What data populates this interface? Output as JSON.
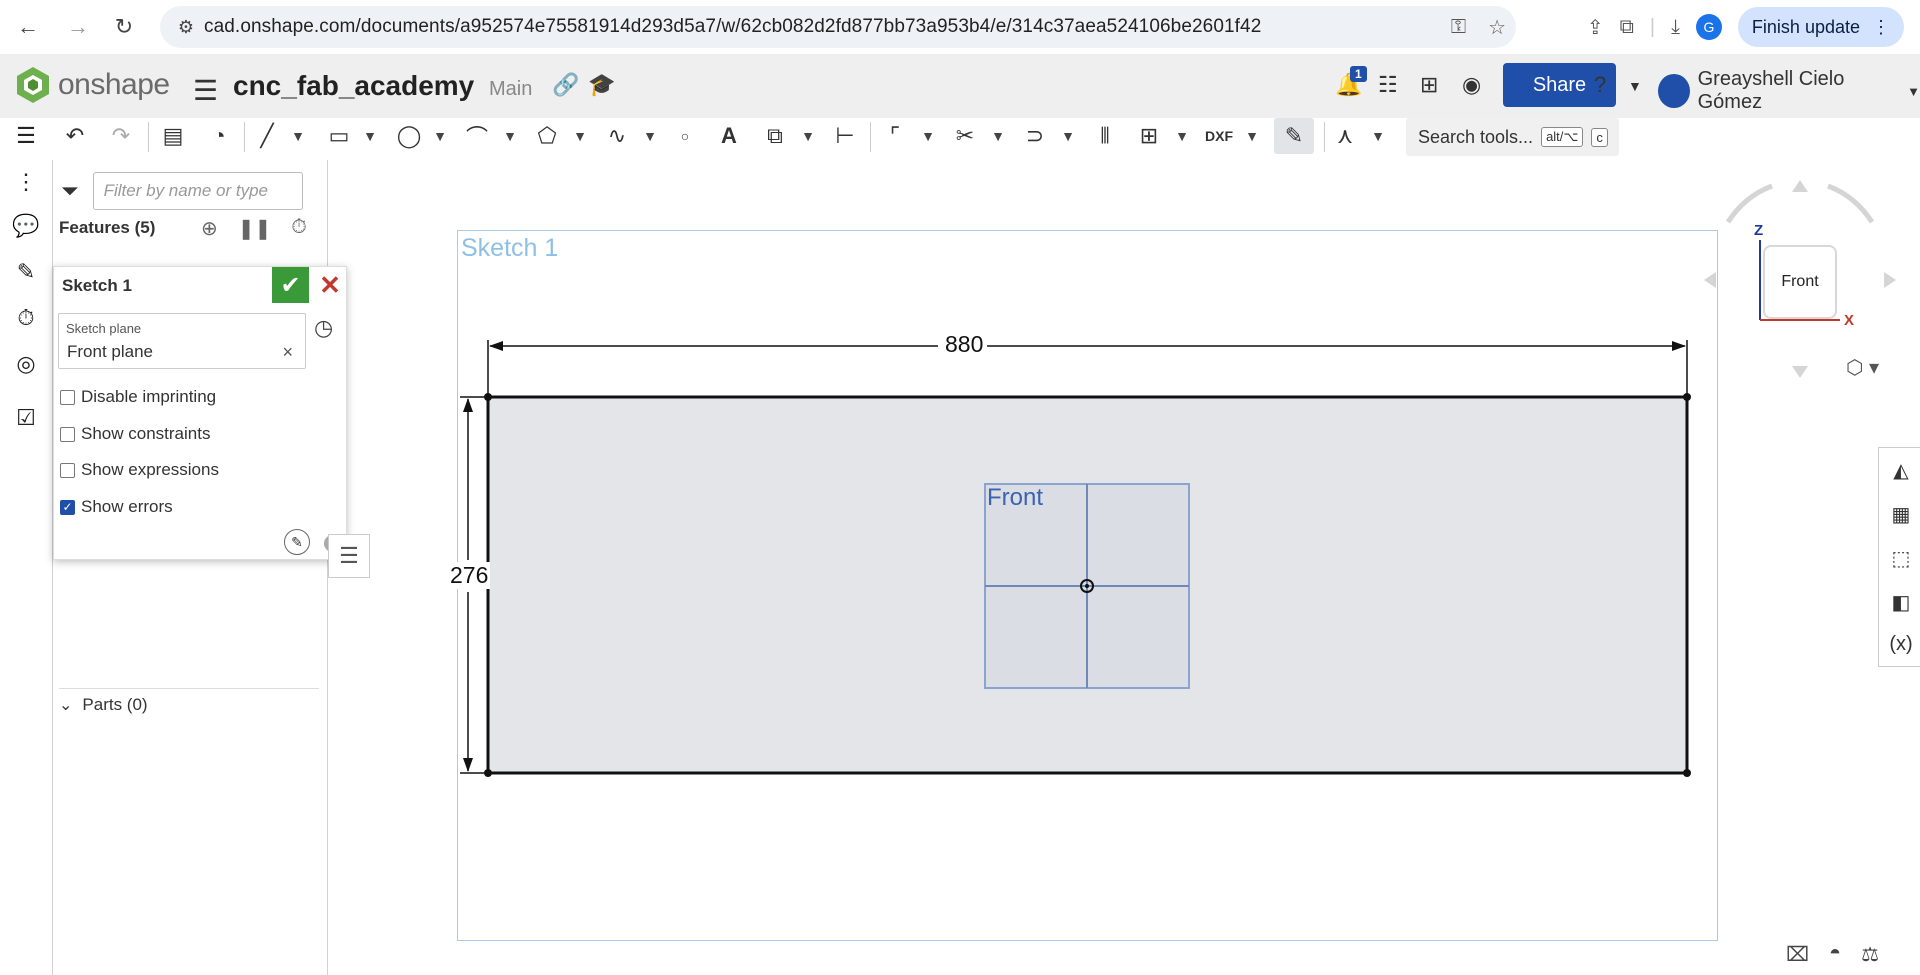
{
  "browser": {
    "url": "cad.onshape.com/documents/a952574e75581914d293d5a7/w/62cb082d2fd877bb73a953b4/e/314c37aea524106be2601f42",
    "profile_initial": "G",
    "finish_update_label": "Finish update"
  },
  "app": {
    "brand": "onshape",
    "document_title": "cnc_fab_academy",
    "branch": "Main",
    "notification_count": "1",
    "share_label": "Share",
    "user_name": "Greayshell Cielo Gómez"
  },
  "toolbar": {
    "search_label": "Search tools...",
    "search_shortcut_1": "alt/⌥",
    "search_shortcut_2": "c"
  },
  "feature_panel": {
    "filter_placeholder": "Filter by name or type",
    "features_label": "Features (5)",
    "parts_label": "Parts (0)"
  },
  "sketch_dialog": {
    "title": "Sketch 1",
    "plane_label": "Sketch plane",
    "plane_value": "Front plane",
    "options": [
      {
        "label": "Disable imprinting",
        "checked": false
      },
      {
        "label": "Show constraints",
        "checked": false
      },
      {
        "label": "Show expressions",
        "checked": false
      },
      {
        "label": "Show errors",
        "checked": true
      }
    ]
  },
  "viewport": {
    "sketch_label": "Sketch 1",
    "dimension_width": "880",
    "dimension_height": "276",
    "plane_label": "Front"
  },
  "view_cube": {
    "face_label": "Front",
    "axis_z": "Z",
    "axis_x": "X"
  },
  "colors": {
    "accent": "#1f4fa8",
    "ok_green": "#3a9a3a",
    "cancel_red": "#c0392b",
    "sketch_fill": "#e3e5e9",
    "sketch_frame": "#a9cbe6"
  }
}
